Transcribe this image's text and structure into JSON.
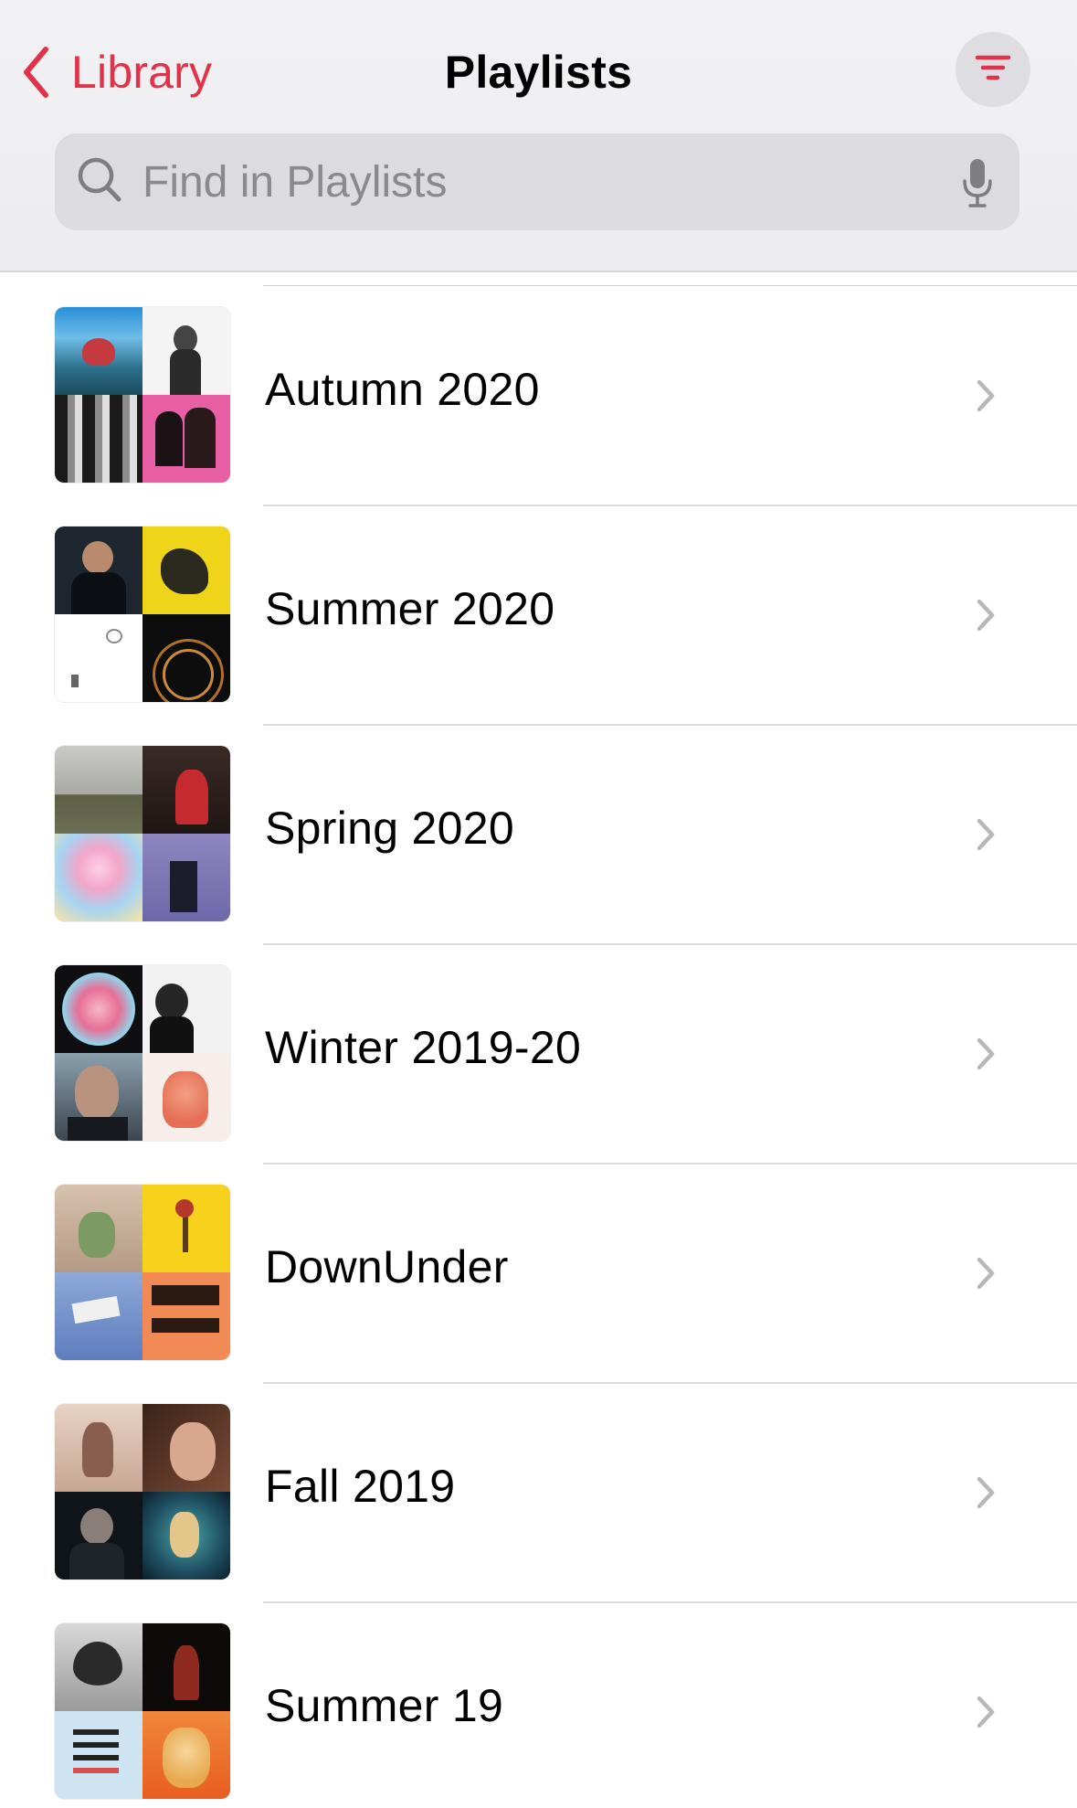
{
  "header": {
    "back_label": "Library",
    "title": "Playlists",
    "sort_icon": "filter-lines-icon"
  },
  "search": {
    "placeholder": "Find in Playlists",
    "value": "",
    "icon": "search-icon",
    "mic_icon": "microphone-icon"
  },
  "colors": {
    "accent": "#e0324a",
    "header_bg": "#efeff2",
    "search_bg": "#dcdce0",
    "separator": "#dcdce0",
    "chevron": "#b8b8bc"
  },
  "playlists": [
    {
      "title": "Autumn 2020"
    },
    {
      "title": "Summer 2020"
    },
    {
      "title": "Spring 2020"
    },
    {
      "title": "Winter 2019-20"
    },
    {
      "title": "DownUnder"
    },
    {
      "title": "Fall 2019"
    },
    {
      "title": "Summer 19"
    }
  ]
}
